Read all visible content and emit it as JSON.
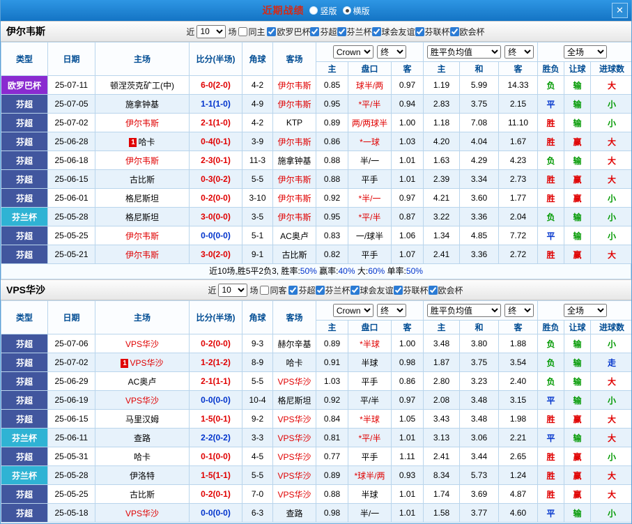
{
  "topbar": {
    "title": "近期战绩",
    "modes": [
      {
        "label": "竖版",
        "selected": false
      },
      {
        "label": "横版",
        "selected": true
      }
    ],
    "close_label": "✕"
  },
  "colors": {
    "titlebar_bg": "#1e82d0",
    "title_text": "#d42a16",
    "grid_border": "#b9d5ec",
    "row_alt": "#e7f2fb",
    "header_text": "#004c93",
    "win_red": "#e00000",
    "lose_green": "#009900",
    "draw_blue": "#0033cc",
    "league_europa": "#8a2bd0",
    "league_veikkausliiga": "#41569e",
    "league_suomen_cup": "#2fb3d4"
  },
  "header": {
    "type": "类型",
    "date": "日期",
    "home": "主场",
    "score": "比分(半场)",
    "corner": "角球",
    "away": "客场",
    "bookmaker": "Crown",
    "odds_stage": "终",
    "avg_label": "胜平负均值",
    "avg_stage": "终",
    "scope": "全场",
    "sub": [
      "主",
      "盘口",
      "客",
      "主",
      "和",
      "客",
      "胜负",
      "让球",
      "进球数"
    ]
  },
  "sections": [
    {
      "team": "伊尔韦斯",
      "filters": {
        "near_label": "近",
        "count": "10",
        "games_label": "场",
        "same_label": "同主",
        "same_checked": false,
        "leagues": [
          {
            "label": "欧罗巴杯",
            "checked": true
          },
          {
            "label": "芬超",
            "checked": true
          },
          {
            "label": "芬兰杯",
            "checked": true
          },
          {
            "label": "球会友谊",
            "checked": true
          },
          {
            "label": "芬联杯",
            "checked": true
          },
          {
            "label": "欧会杯",
            "checked": true
          }
        ]
      },
      "rows": [
        {
          "league": "欧罗巴杯",
          "league_color": "#8a2bd0",
          "date": "25-07-11",
          "card": "",
          "home": "顿涅茨克矿工(中)",
          "home_color": "#000000",
          "score": "6-0(2-0)",
          "score_color": "#e00000",
          "corners": "4-2",
          "away": "伊尔韦斯",
          "away_color": "#e00000",
          "odds_home": "0.85",
          "handicap": "球半/两",
          "handicap_color": "#e00000",
          "odds_away": "0.97",
          "avg_home": "1.19",
          "avg_draw": "5.99",
          "avg_away": "14.33",
          "res_wdl": "负",
          "res_wdl_color": "#009900",
          "res_handicap": "输",
          "res_handicap_color": "#009900",
          "res_goals": "大",
          "res_goals_color": "#e00000"
        },
        {
          "league": "芬超",
          "league_color": "#41569e",
          "date": "25-07-05",
          "card": "",
          "home": "施拿钟基",
          "home_color": "#000000",
          "score": "1-1(1-0)",
          "score_color": "#0033cc",
          "corners": "4-9",
          "away": "伊尔韦斯",
          "away_color": "#e00000",
          "odds_home": "0.95",
          "handicap": "*平/半",
          "handicap_color": "#e00000",
          "odds_away": "0.94",
          "avg_home": "2.83",
          "avg_draw": "3.75",
          "avg_away": "2.15",
          "res_wdl": "平",
          "res_wdl_color": "#0033cc",
          "res_handicap": "输",
          "res_handicap_color": "#009900",
          "res_goals": "小",
          "res_goals_color": "#009900"
        },
        {
          "league": "芬超",
          "league_color": "#41569e",
          "date": "25-07-02",
          "card": "",
          "home": "伊尔韦斯",
          "home_color": "#e00000",
          "score": "2-1(1-0)",
          "score_color": "#e00000",
          "corners": "4-2",
          "away": "KTP",
          "away_color": "#000000",
          "odds_home": "0.89",
          "handicap": "两/两球半",
          "handicap_color": "#e00000",
          "odds_away": "1.00",
          "avg_home": "1.18",
          "avg_draw": "7.08",
          "avg_away": "11.10",
          "res_wdl": "胜",
          "res_wdl_color": "#e00000",
          "res_handicap": "输",
          "res_handicap_color": "#009900",
          "res_goals": "小",
          "res_goals_color": "#009900"
        },
        {
          "league": "芬超",
          "league_color": "#41569e",
          "date": "25-06-28",
          "card": "1",
          "home": "哈卡",
          "home_color": "#000000",
          "score": "0-4(0-1)",
          "score_color": "#e00000",
          "corners": "3-9",
          "away": "伊尔韦斯",
          "away_color": "#e00000",
          "odds_home": "0.86",
          "handicap": "*一球",
          "handicap_color": "#e00000",
          "odds_away": "1.03",
          "avg_home": "4.20",
          "avg_draw": "4.04",
          "avg_away": "1.67",
          "res_wdl": "胜",
          "res_wdl_color": "#e00000",
          "res_handicap": "赢",
          "res_handicap_color": "#e00000",
          "res_goals": "大",
          "res_goals_color": "#e00000"
        },
        {
          "league": "芬超",
          "league_color": "#41569e",
          "date": "25-06-18",
          "card": "",
          "home": "伊尔韦斯",
          "home_color": "#e00000",
          "score": "2-3(0-1)",
          "score_color": "#e00000",
          "corners": "11-3",
          "away": "施拿钟基",
          "away_color": "#000000",
          "odds_home": "0.88",
          "handicap": "半/一",
          "handicap_color": "#000000",
          "odds_away": "1.01",
          "avg_home": "1.63",
          "avg_draw": "4.29",
          "avg_away": "4.23",
          "res_wdl": "负",
          "res_wdl_color": "#009900",
          "res_handicap": "输",
          "res_handicap_color": "#009900",
          "res_goals": "大",
          "res_goals_color": "#e00000"
        },
        {
          "league": "芬超",
          "league_color": "#41569e",
          "date": "25-06-15",
          "card": "",
          "home": "古比斯",
          "home_color": "#000000",
          "score": "0-3(0-2)",
          "score_color": "#e00000",
          "corners": "5-5",
          "away": "伊尔韦斯",
          "away_color": "#e00000",
          "odds_home": "0.88",
          "handicap": "平手",
          "handicap_color": "#000000",
          "odds_away": "1.01",
          "avg_home": "2.39",
          "avg_draw": "3.34",
          "avg_away": "2.73",
          "res_wdl": "胜",
          "res_wdl_color": "#e00000",
          "res_handicap": "赢",
          "res_handicap_color": "#e00000",
          "res_goals": "大",
          "res_goals_color": "#e00000"
        },
        {
          "league": "芬超",
          "league_color": "#41569e",
          "date": "25-06-01",
          "card": "",
          "home": "格尼斯坦",
          "home_color": "#000000",
          "score": "0-2(0-0)",
          "score_color": "#e00000",
          "corners": "3-10",
          "away": "伊尔韦斯",
          "away_color": "#e00000",
          "odds_home": "0.92",
          "handicap": "*半/一",
          "handicap_color": "#e00000",
          "odds_away": "0.97",
          "avg_home": "4.21",
          "avg_draw": "3.60",
          "avg_away": "1.77",
          "res_wdl": "胜",
          "res_wdl_color": "#e00000",
          "res_handicap": "赢",
          "res_handicap_color": "#e00000",
          "res_goals": "小",
          "res_goals_color": "#009900"
        },
        {
          "league": "芬兰杯",
          "league_color": "#2fb3d4",
          "date": "25-05-28",
          "card": "",
          "home": "格尼斯坦",
          "home_color": "#000000",
          "score": "3-0(0-0)",
          "score_color": "#e00000",
          "corners": "3-5",
          "away": "伊尔韦斯",
          "away_color": "#e00000",
          "odds_home": "0.95",
          "handicap": "*平/半",
          "handicap_color": "#e00000",
          "odds_away": "0.87",
          "avg_home": "3.22",
          "avg_draw": "3.36",
          "avg_away": "2.04",
          "res_wdl": "负",
          "res_wdl_color": "#009900",
          "res_handicap": "输",
          "res_handicap_color": "#009900",
          "res_goals": "小",
          "res_goals_color": "#009900"
        },
        {
          "league": "芬超",
          "league_color": "#41569e",
          "date": "25-05-25",
          "card": "",
          "home": "伊尔韦斯",
          "home_color": "#e00000",
          "score": "0-0(0-0)",
          "score_color": "#0033cc",
          "corners": "5-1",
          "away": "AC奥卢",
          "away_color": "#000000",
          "odds_home": "0.83",
          "handicap": "一/球半",
          "handicap_color": "#000000",
          "odds_away": "1.06",
          "avg_home": "1.34",
          "avg_draw": "4.85",
          "avg_away": "7.72",
          "res_wdl": "平",
          "res_wdl_color": "#0033cc",
          "res_handicap": "输",
          "res_handicap_color": "#009900",
          "res_goals": "小",
          "res_goals_color": "#009900"
        },
        {
          "league": "芬超",
          "league_color": "#41569e",
          "date": "25-05-21",
          "card": "",
          "home": "伊尔韦斯",
          "home_color": "#e00000",
          "score": "3-0(2-0)",
          "score_color": "#e00000",
          "corners": "9-1",
          "away": "古比斯",
          "away_color": "#000000",
          "odds_home": "0.82",
          "handicap": "平手",
          "handicap_color": "#000000",
          "odds_away": "1.07",
          "avg_home": "2.41",
          "avg_draw": "3.36",
          "avg_away": "2.72",
          "res_wdl": "胜",
          "res_wdl_color": "#e00000",
          "res_handicap": "赢",
          "res_handicap_color": "#e00000",
          "res_goals": "大",
          "res_goals_color": "#e00000"
        }
      ],
      "summary": [
        {
          "text": "近10场,胜5平2负3, ",
          "color": "#000000"
        },
        {
          "text": "胜率:",
          "color": "#000000"
        },
        {
          "text": "50%",
          "color": "#0033cc"
        },
        {
          "text": " 赢率:",
          "color": "#000000"
        },
        {
          "text": "40%",
          "color": "#0033cc"
        },
        {
          "text": " 大:",
          "color": "#000000"
        },
        {
          "text": "60%",
          "color": "#0033cc"
        },
        {
          "text": " 单率:",
          "color": "#000000"
        },
        {
          "text": "50%",
          "color": "#0033cc"
        }
      ]
    },
    {
      "team": "VPS华沙",
      "filters": {
        "near_label": "近",
        "count": "10",
        "games_label": "场",
        "same_label": "同客",
        "same_checked": false,
        "leagues": [
          {
            "label": "芬超",
            "checked": true
          },
          {
            "label": "芬兰杯",
            "checked": true
          },
          {
            "label": "球会友谊",
            "checked": true
          },
          {
            "label": "芬联杯",
            "checked": true
          },
          {
            "label": "欧会杯",
            "checked": true
          }
        ]
      },
      "rows": [
        {
          "league": "芬超",
          "league_color": "#41569e",
          "date": "25-07-06",
          "card": "",
          "home": "VPS华沙",
          "home_color": "#e00000",
          "score": "0-2(0-0)",
          "score_color": "#e00000",
          "corners": "9-3",
          "away": "赫尔辛基",
          "away_color": "#000000",
          "odds_home": "0.89",
          "handicap": "*半球",
          "handicap_color": "#e00000",
          "odds_away": "1.00",
          "avg_home": "3.48",
          "avg_draw": "3.80",
          "avg_away": "1.88",
          "res_wdl": "负",
          "res_wdl_color": "#009900",
          "res_handicap": "输",
          "res_handicap_color": "#009900",
          "res_goals": "小",
          "res_goals_color": "#009900"
        },
        {
          "league": "芬超",
          "league_color": "#41569e",
          "date": "25-07-02",
          "card": "1",
          "home": "VPS华沙",
          "home_color": "#e00000",
          "score": "1-2(1-2)",
          "score_color": "#e00000",
          "corners": "8-9",
          "away": "哈卡",
          "away_color": "#000000",
          "odds_home": "0.91",
          "handicap": "半球",
          "handicap_color": "#000000",
          "odds_away": "0.98",
          "avg_home": "1.87",
          "avg_draw": "3.75",
          "avg_away": "3.54",
          "res_wdl": "负",
          "res_wdl_color": "#009900",
          "res_handicap": "输",
          "res_handicap_color": "#009900",
          "res_goals": "走",
          "res_goals_color": "#0033cc"
        },
        {
          "league": "芬超",
          "league_color": "#41569e",
          "date": "25-06-29",
          "card": "",
          "home": "AC奥卢",
          "home_color": "#000000",
          "score": "2-1(1-1)",
          "score_color": "#e00000",
          "corners": "5-5",
          "away": "VPS华沙",
          "away_color": "#e00000",
          "odds_home": "1.03",
          "handicap": "平手",
          "handicap_color": "#000000",
          "odds_away": "0.86",
          "avg_home": "2.80",
          "avg_draw": "3.23",
          "avg_away": "2.40",
          "res_wdl": "负",
          "res_wdl_color": "#009900",
          "res_handicap": "输",
          "res_handicap_color": "#009900",
          "res_goals": "大",
          "res_goals_color": "#e00000"
        },
        {
          "league": "芬超",
          "league_color": "#41569e",
          "date": "25-06-19",
          "card": "",
          "home": "VPS华沙",
          "home_color": "#e00000",
          "score": "0-0(0-0)",
          "score_color": "#0033cc",
          "corners": "10-4",
          "away": "格尼斯坦",
          "away_color": "#000000",
          "odds_home": "0.92",
          "handicap": "平/半",
          "handicap_color": "#000000",
          "odds_away": "0.97",
          "avg_home": "2.08",
          "avg_draw": "3.48",
          "avg_away": "3.15",
          "res_wdl": "平",
          "res_wdl_color": "#0033cc",
          "res_handicap": "输",
          "res_handicap_color": "#009900",
          "res_goals": "小",
          "res_goals_color": "#009900"
        },
        {
          "league": "芬超",
          "league_color": "#41569e",
          "date": "25-06-15",
          "card": "",
          "home": "马里汉姆",
          "home_color": "#000000",
          "score": "1-5(0-1)",
          "score_color": "#e00000",
          "corners": "9-2",
          "away": "VPS华沙",
          "away_color": "#e00000",
          "odds_home": "0.84",
          "handicap": "*半球",
          "handicap_color": "#e00000",
          "odds_away": "1.05",
          "avg_home": "3.43",
          "avg_draw": "3.48",
          "avg_away": "1.98",
          "res_wdl": "胜",
          "res_wdl_color": "#e00000",
          "res_handicap": "赢",
          "res_handicap_color": "#e00000",
          "res_goals": "大",
          "res_goals_color": "#e00000"
        },
        {
          "league": "芬兰杯",
          "league_color": "#2fb3d4",
          "date": "25-06-11",
          "card": "",
          "home": "查路",
          "home_color": "#000000",
          "score": "2-2(0-2)",
          "score_color": "#0033cc",
          "corners": "3-3",
          "away": "VPS华沙",
          "away_color": "#e00000",
          "odds_home": "0.81",
          "handicap": "*平/半",
          "handicap_color": "#e00000",
          "odds_away": "1.01",
          "avg_home": "3.13",
          "avg_draw": "3.06",
          "avg_away": "2.21",
          "res_wdl": "平",
          "res_wdl_color": "#0033cc",
          "res_handicap": "输",
          "res_handicap_color": "#009900",
          "res_goals": "大",
          "res_goals_color": "#e00000"
        },
        {
          "league": "芬超",
          "league_color": "#41569e",
          "date": "25-05-31",
          "card": "",
          "home": "哈卡",
          "home_color": "#000000",
          "score": "0-1(0-0)",
          "score_color": "#e00000",
          "corners": "4-5",
          "away": "VPS华沙",
          "away_color": "#e00000",
          "odds_home": "0.77",
          "handicap": "平手",
          "handicap_color": "#000000",
          "odds_away": "1.11",
          "avg_home": "2.41",
          "avg_draw": "3.44",
          "avg_away": "2.65",
          "res_wdl": "胜",
          "res_wdl_color": "#e00000",
          "res_handicap": "赢",
          "res_handicap_color": "#e00000",
          "res_goals": "小",
          "res_goals_color": "#009900"
        },
        {
          "league": "芬兰杯",
          "league_color": "#2fb3d4",
          "date": "25-05-28",
          "card": "",
          "home": "伊洛特",
          "home_color": "#000000",
          "score": "1-5(1-1)",
          "score_color": "#e00000",
          "corners": "5-5",
          "away": "VPS华沙",
          "away_color": "#e00000",
          "odds_home": "0.89",
          "handicap": "*球半/两",
          "handicap_color": "#e00000",
          "odds_away": "0.93",
          "avg_home": "8.34",
          "avg_draw": "5.73",
          "avg_away": "1.24",
          "res_wdl": "胜",
          "res_wdl_color": "#e00000",
          "res_handicap": "赢",
          "res_handicap_color": "#e00000",
          "res_goals": "大",
          "res_goals_color": "#e00000"
        },
        {
          "league": "芬超",
          "league_color": "#41569e",
          "date": "25-05-25",
          "card": "",
          "home": "古比斯",
          "home_color": "#000000",
          "score": "0-2(0-1)",
          "score_color": "#e00000",
          "corners": "7-0",
          "away": "VPS华沙",
          "away_color": "#e00000",
          "odds_home": "0.88",
          "handicap": "半球",
          "handicap_color": "#000000",
          "odds_away": "1.01",
          "avg_home": "1.74",
          "avg_draw": "3.69",
          "avg_away": "4.87",
          "res_wdl": "胜",
          "res_wdl_color": "#e00000",
          "res_handicap": "赢",
          "res_handicap_color": "#e00000",
          "res_goals": "大",
          "res_goals_color": "#e00000"
        },
        {
          "league": "芬超",
          "league_color": "#41569e",
          "date": "25-05-18",
          "card": "",
          "home": "VPS华沙",
          "home_color": "#e00000",
          "score": "0-0(0-0)",
          "score_color": "#0033cc",
          "corners": "6-3",
          "away": "查路",
          "away_color": "#000000",
          "odds_home": "0.98",
          "handicap": "半/一",
          "handicap_color": "#000000",
          "odds_away": "1.01",
          "avg_home": "1.58",
          "avg_draw": "3.77",
          "avg_away": "4.60",
          "res_wdl": "平",
          "res_wdl_color": "#0033cc",
          "res_handicap": "输",
          "res_handicap_color": "#009900",
          "res_goals": "小",
          "res_goals_color": "#009900"
        }
      ]
    }
  ]
}
